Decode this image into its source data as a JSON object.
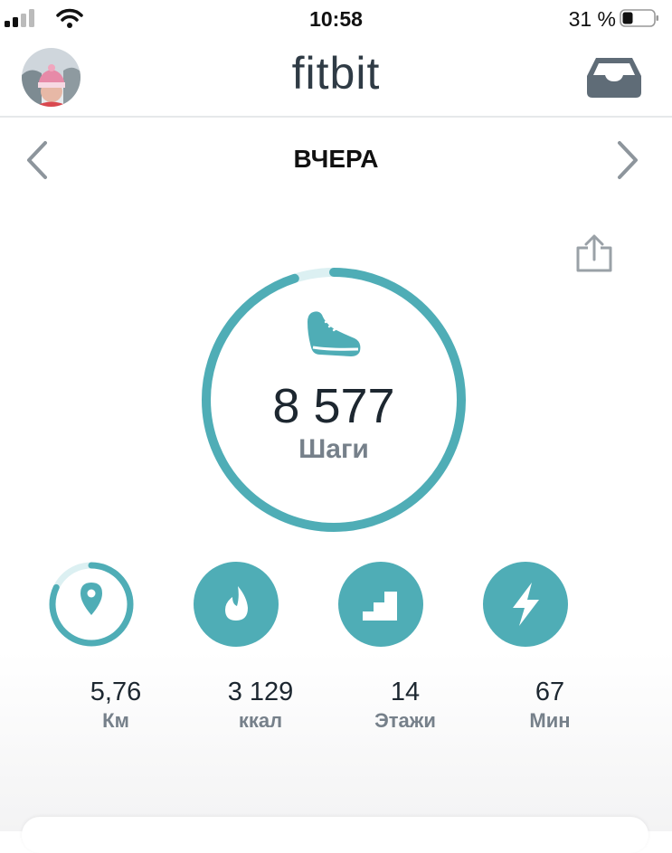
{
  "status_bar": {
    "time": "10:58",
    "battery": "31 %"
  },
  "header": {
    "logo": "fitbit"
  },
  "date_nav": {
    "label": "ВЧЕРА"
  },
  "steps": {
    "value": "8 577",
    "label": "Шаги",
    "progress": 0.95
  },
  "stats": [
    {
      "value": "5,76",
      "unit": "Км",
      "icon": "location-pin-icon",
      "progress": 0.82
    },
    {
      "value": "3 129",
      "unit": "ккал",
      "icon": "flame-icon",
      "progress": 1
    },
    {
      "value": "14",
      "unit": "Этажи",
      "icon": "stairs-icon",
      "progress": 1
    },
    {
      "value": "67",
      "unit": "Мин",
      "icon": "lightning-icon",
      "progress": 1
    }
  ],
  "colors": {
    "accent": "#4fadb6",
    "track": "#dcf0f2",
    "text": "#1d2730",
    "muted": "#76808a"
  }
}
